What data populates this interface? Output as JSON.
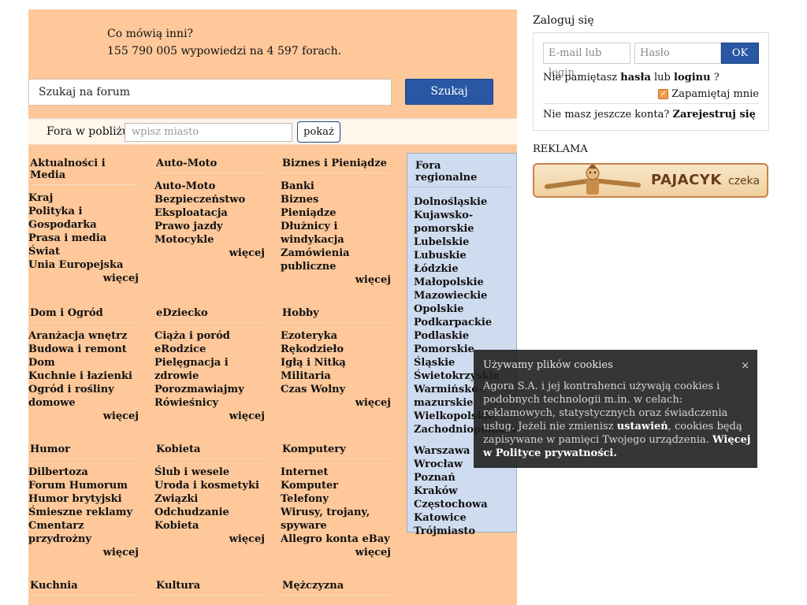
{
  "stats": {
    "line1": "Co mówią inni?",
    "line2": "155 790 005 wypowiedzi na 4 597 forach."
  },
  "search": {
    "placeholder": "Szukaj na forum",
    "button": "Szukaj"
  },
  "nearby": {
    "label": "Fora w pobliżu:",
    "placeholder": "wpisz miasto",
    "button": "pokaż"
  },
  "categories": [
    {
      "title": "Aktualności i Media",
      "items": [
        "Kraj",
        "Polityka i Gospodarka",
        "Prasa i media",
        "Świat",
        "Unia Europejska"
      ],
      "more": "więcej"
    },
    {
      "title": "Auto-Moto",
      "items": [
        "Auto-Moto",
        "Bezpieczeństwo",
        "Eksploatacja",
        "Prawo jazdy",
        "Motocykle"
      ],
      "more": "więcej"
    },
    {
      "title": "Biznes i Pieniądze",
      "items": [
        "Banki",
        "Biznes",
        "Pieniądze",
        "Dłużnicy i windykacja",
        "Zamówienia publiczne"
      ],
      "more": "więcej"
    },
    {
      "title": "Dom i Ogród",
      "items": [
        "Aranżacja wnętrz",
        "Budowa i remont",
        "Dom",
        "Kuchnie i łazienki",
        "Ogród i rośliny domowe"
      ],
      "more": "więcej"
    },
    {
      "title": "eDziecko",
      "items": [
        "Ciąża i poród",
        "eRodzice",
        "Pielęgnacja i zdrowie",
        "Porozmawiajmy",
        "Rówieśnicy"
      ],
      "more": "więcej"
    },
    {
      "title": "Hobby",
      "items": [
        "Ezoteryka",
        "Rękodzieło",
        "Igłą i Nitką",
        "Militaria",
        "Czas Wolny"
      ],
      "more": "więcej"
    },
    {
      "title": "Humor",
      "items": [
        "Dilbertoza",
        "Forum Humorum",
        "Humor brytyjski",
        "Śmieszne reklamy",
        "Cmentarz przydrożny"
      ],
      "more": "więcej"
    },
    {
      "title": "Kobieta",
      "items": [
        "Ślub i wesele",
        "Uroda i kosmetyki",
        "Związki",
        "Odchudzanie",
        "Kobieta"
      ],
      "more": "więcej"
    },
    {
      "title": "Komputery",
      "items": [
        "Internet",
        "Komputer",
        "Telefony",
        "Wirusy, trojany, spyware",
        "Allegro konta eBay"
      ],
      "more": "więcej"
    },
    {
      "title": "Kuchnia",
      "items": [],
      "more": ""
    },
    {
      "title": "Kultura",
      "items": [],
      "more": ""
    },
    {
      "title": "Mężczyzna",
      "items": [],
      "more": ""
    }
  ],
  "regional": {
    "title": "Fora regionalne",
    "regions": [
      "Dolnośląskie",
      "Kujawsko-pomorskie",
      "Lubelskie",
      "Lubuskie",
      "Łódzkie",
      "Małopolskie",
      "Mazowieckie",
      "Opolskie",
      "Podkarpackie",
      "Podlaskie",
      "Pomorskie",
      "Śląskie",
      "Świetokrzyskie",
      "Warmińsko-mazurskie",
      "Wielkopolskie",
      "Zachodniopomorskie"
    ],
    "cities": [
      "Warszawa",
      "Wrocław",
      "Poznań",
      "Kraków",
      "Częstochowa",
      "Katowice",
      "Trójmiasto"
    ]
  },
  "login": {
    "heading": "Zaloguj się",
    "email_placeholder": "E-mail lub login",
    "password_placeholder": "Hasło",
    "ok": "OK",
    "forgot_prefix": "Nie pamiętasz",
    "forgot_password": "hasła",
    "forgot_or": "lub",
    "forgot_login": "loginu",
    "forgot_suffix": "?",
    "remember": "Zapamiętaj mnie",
    "no_account": "Nie masz jeszcze konta?",
    "register": "Zarejestruj się"
  },
  "ad": {
    "label": "REKLAMA",
    "brand": "PAJACYK",
    "tagline": "czeka"
  },
  "cookie": {
    "title": "Używamy plików cookies",
    "close": "×",
    "body_1": "Agora S.A. i jej kontrahenci używają cookies i podobnych technologii m.in. w celach: reklamowych, statystycznych oraz świadczenia usług. Jeżeli nie zmienisz",
    "body_settings": "ustawień",
    "body_2": ", cookies będą zapisywane w pamięci Twojego urządzenia.",
    "body_policy": "Więcej w Polityce prywatności."
  },
  "colors": {
    "main_bg": "#fec89a",
    "regional_bg": "#cfdcef",
    "button_blue": "#2957a4",
    "checkbox_orange": "#f39c4c"
  }
}
